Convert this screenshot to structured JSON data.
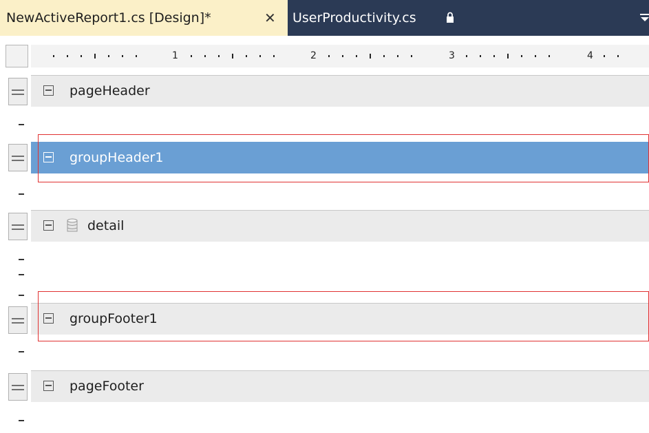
{
  "tabs": [
    {
      "label": "NewActiveReport1.cs [Design]*",
      "active": true,
      "close_icon": "close-icon"
    },
    {
      "label": "UserProductivity.cs",
      "active": false,
      "icon": "lock-icon"
    }
  ],
  "ruler": {
    "marks": [
      "1",
      "2",
      "3",
      "4"
    ]
  },
  "bands": [
    {
      "name": "pageHeader",
      "selected": false,
      "highlighted": false
    },
    {
      "name": "groupHeader1",
      "selected": true,
      "highlighted": true
    },
    {
      "name": "detail",
      "selected": false,
      "highlighted": false,
      "icon": "database-icon"
    },
    {
      "name": "groupFooter1",
      "selected": false,
      "highlighted": true
    },
    {
      "name": "pageFooter",
      "selected": false,
      "highlighted": false
    }
  ],
  "colors": {
    "tab_bar": "#2b3a55",
    "active_tab": "#fbf0c8",
    "selected_band": "#6a9fd4",
    "highlight": "#e03131"
  }
}
